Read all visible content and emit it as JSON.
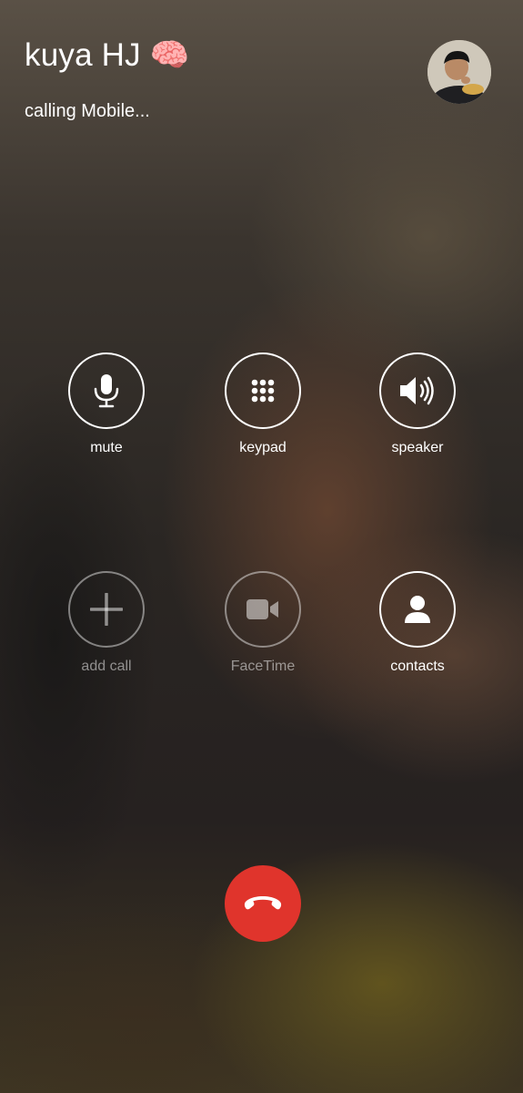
{
  "call": {
    "contact_name": "kuya HJ 🧠",
    "status": "calling Mobile..."
  },
  "controls": {
    "mute": {
      "label": "mute",
      "icon": "microphone-icon",
      "enabled": true
    },
    "keypad": {
      "label": "keypad",
      "icon": "keypad-icon",
      "enabled": true
    },
    "speaker": {
      "label": "speaker",
      "icon": "speaker-icon",
      "enabled": true
    },
    "add_call": {
      "label": "add call",
      "icon": "plus-icon",
      "enabled": false
    },
    "facetime": {
      "label": "FaceTime",
      "icon": "video-camera-icon",
      "enabled": false
    },
    "contacts": {
      "label": "contacts",
      "icon": "person-icon",
      "enabled": true
    }
  },
  "end_call": {
    "icon": "phone-hangup-icon",
    "color": "#e0342c"
  },
  "colors": {
    "text": "#ffffff",
    "end_call_red": "#e0342c"
  }
}
